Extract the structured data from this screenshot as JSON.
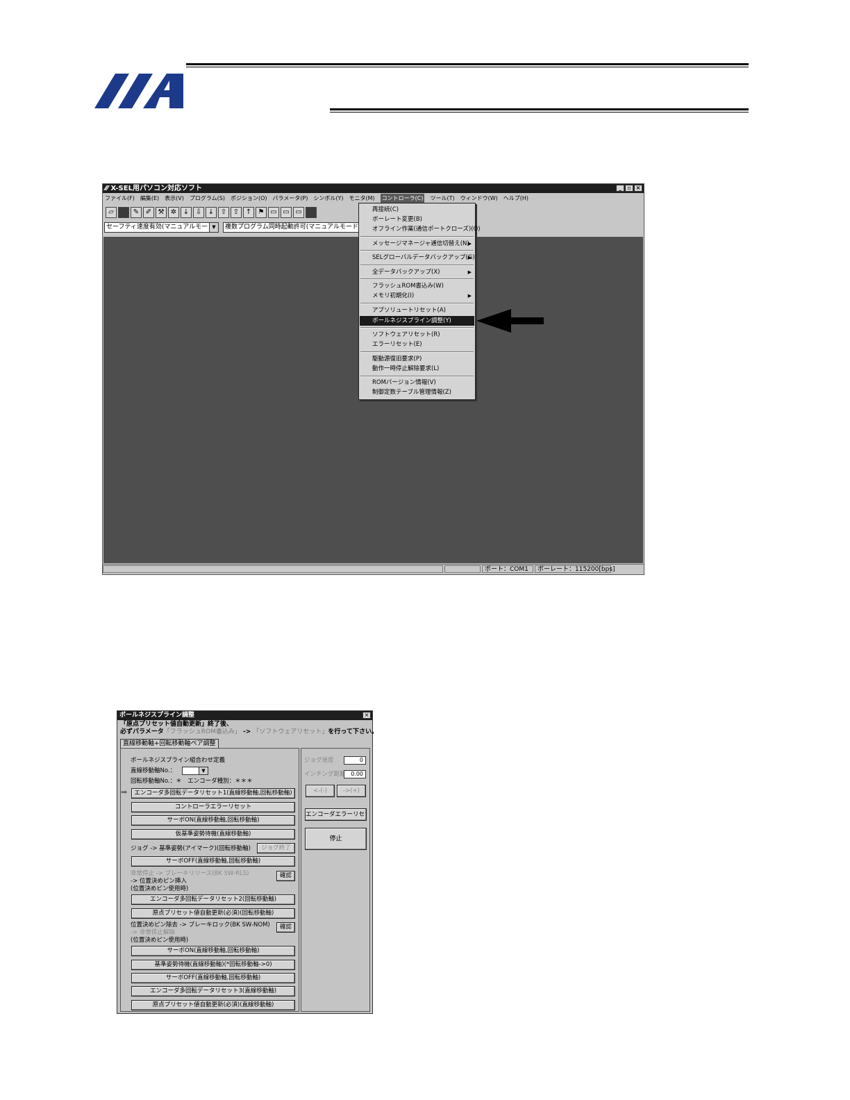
{
  "screenshot1": {
    "title": "X-SEL用パソコン対応ソフト",
    "window_buttons": [
      "_",
      "▫",
      "×"
    ],
    "menus": [
      "ファイル(F)",
      "編集(E)",
      "表示(V)",
      "プログラム(S)",
      "ポジション(O)",
      "パラメータ(P)",
      "シンボル(Y)",
      "モニタ(M)",
      "コントローラ(C)",
      "ツール(T)",
      "ウィンドウ(W)",
      "ヘルプ(H)"
    ],
    "active_menu": "コントローラ(C)",
    "combo1": "セーフティ速度有効(マニュアルモード時)",
    "combo2": "複数プログラム同時起動許可(マニュアルモード時)",
    "status_port": "ポート：COM1",
    "status_baud": "ボーレート：115200[bps]",
    "controller_menu": [
      {
        "label": "再接続(C)"
      },
      {
        "label": "ボーレート変更(B)"
      },
      {
        "label": "オフライン作業(通信ポートクローズ)(O)"
      },
      {
        "label": "メッセージマネージャ通信切替え(N)",
        "submenu": true
      },
      {
        "label": "SELグローバルデータバックアップ(G)",
        "submenu": true
      },
      {
        "label": "全データバックアップ(X)",
        "submenu": true
      },
      {
        "label": "フラッシュROM書込み(W)"
      },
      {
        "label": "メモリ初期化(I)",
        "submenu": true
      },
      {
        "label": "アブソリュートリセット(A)"
      },
      {
        "label": "ボールネジスプライン調整(Y)",
        "selected": true
      },
      {
        "label": "ソフトウェアリセット(R)"
      },
      {
        "label": "エラーリセット(E)"
      },
      {
        "label": "駆動源復旧要求(P)"
      },
      {
        "label": "動作一時停止解除要求(L)"
      },
      {
        "label": "ROMバージョン情報(V)"
      },
      {
        "label": "制御定数テーブル管理情報(Z)"
      }
    ]
  },
  "dialog": {
    "title": "ボールネジスプライン調整",
    "close": "×",
    "msg_line1": "「原点プリセット値自動更新」終了後、",
    "msg_line2a": "必ずパラメータ",
    "msg_line2b": "「フラッシュROM書込み」",
    "msg_line2c": " -> ",
    "msg_line2d": "「ソフトウェアリセット」",
    "msg_line2e": "を行って下さい。",
    "tab": "直線移動軸+回転移動軸ペア調整",
    "combo_def_label": "ボールネジスプライン組合わせ定義",
    "linear_axis_label": "直線移動軸No.：",
    "rotary_axis_label": "回転移動軸No.：＊　エンコーダ種別：＊＊＊",
    "btn1": "エンコーダ多回転データリセット1(直線移動軸,回転移動軸)",
    "btn2": "コントローラエラーリセット",
    "btn3": "サーボON(直線移動軸,回転移動軸)",
    "btn4": "仮基準姿勢待機(直線移動軸)",
    "jog_label": "ジョグ -> 基準姿勢(アイマーク)(回転移動軸)",
    "jog_end": "ジョグ終了",
    "btn5": "サーボOFF(直線移動軸,回転移動軸)",
    "estop_1": "非常停止 -> ブレーキリリース(BK SW-RLS)",
    "estop_2": " -> 位置決めピン挿入",
    "estop_3": "(位置決めピン使用時)",
    "confirm1": "確認",
    "btn6": "エンコーダ多回転データリセット2(回転移動軸)",
    "btn7": "原点プリセット値自動更新(必須)(回転移動軸)",
    "pin_1": "位置決めピン除去 -> ブレーキロック(BK SW-NOM)",
    "pin_2": " -> 非常停止解除",
    "pin_3": "(位置決めピン使用時)",
    "confirm2": "確認",
    "btn8": "サーボON(直線移動軸,回転移動軸)",
    "btn9": "基準姿勢待機(直線移動軸)(*回転移動軸->0)",
    "btn10": "サーボOFF(直線移動軸,回転移動軸)",
    "btn11": "エンコーダ多回転データリセット3(直線移動軸)",
    "btn12": "原点プリセット値自動更新(必須)(直線移動軸)",
    "jog_speed_label": "ジョグ速度",
    "jog_speed_value": "0",
    "inching_label": "インチング距離",
    "inching_value": "0.00",
    "jog_minus": "<-(-)",
    "jog_plus": "->(+)",
    "enc_err_reset": "エンコーダエラーリセット",
    "stop": "停止"
  },
  "colors": {
    "logo": "#1d3a8a",
    "client": "#4e4e4e",
    "selected": "#1a1a1a"
  }
}
